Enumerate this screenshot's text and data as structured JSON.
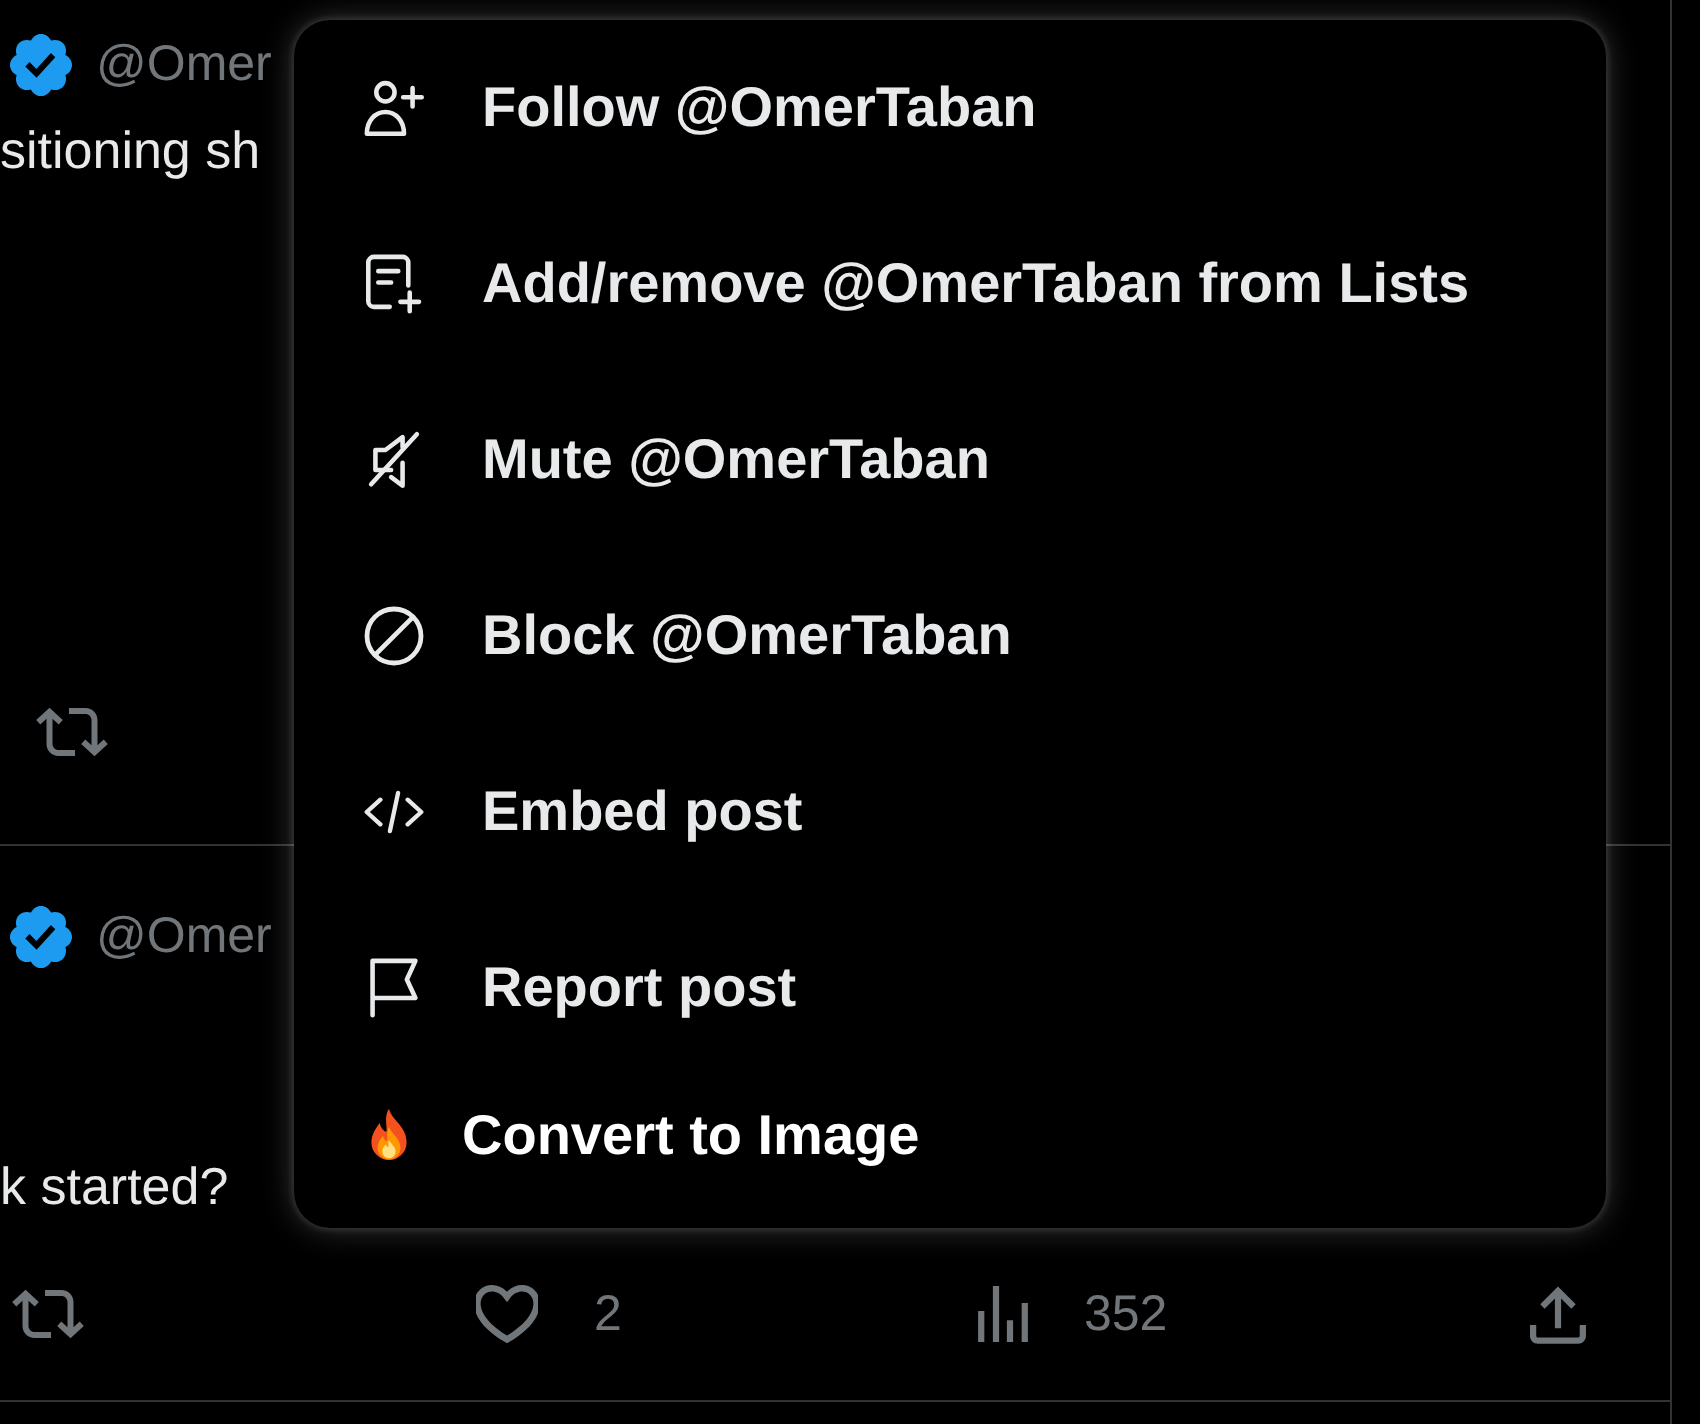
{
  "posts": [
    {
      "verified": true,
      "handle": "@Omer",
      "text": "sitioning sh",
      "actions": [
        {
          "kind": "repost"
        }
      ]
    },
    {
      "verified": true,
      "handle": "@Omer",
      "text": "k started?",
      "actions": [
        {
          "kind": "repost"
        },
        {
          "kind": "like",
          "count": "2"
        },
        {
          "kind": "views",
          "count": "352"
        },
        {
          "kind": "share"
        }
      ]
    }
  ],
  "menu": {
    "items": [
      {
        "kind": "follow",
        "label": "Follow @OmerTaban"
      },
      {
        "kind": "list",
        "label": "Add/remove @OmerTaban from Lists"
      },
      {
        "kind": "mute",
        "label": "Mute @OmerTaban"
      },
      {
        "kind": "block",
        "label": "Block @OmerTaban"
      },
      {
        "kind": "embed",
        "label": "Embed post"
      },
      {
        "kind": "report",
        "label": "Report post"
      },
      {
        "kind": "convert",
        "label": "Convert to Image"
      }
    ]
  }
}
